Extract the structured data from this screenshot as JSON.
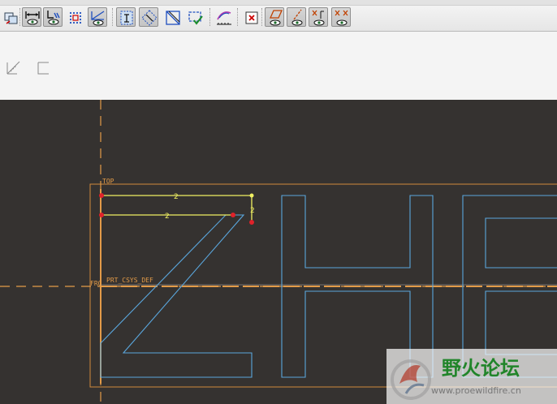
{
  "toolbar": {
    "items": [
      {
        "name": "import-icon",
        "active": false
      },
      {
        "name": "dimension-display-icon",
        "active": true
      },
      {
        "name": "constraint-display-icon",
        "active": true
      },
      {
        "name": "grid-display-icon",
        "active": false
      },
      {
        "name": "vertex-display-icon",
        "active": true
      },
      {
        "name": "shade-closed-loops-icon",
        "active": true
      },
      {
        "name": "highlight-open-ends-icon",
        "active": true
      },
      {
        "name": "overlapping-geometry-icon",
        "active": false
      },
      {
        "name": "sketch-check-icon",
        "active": false
      },
      {
        "name": "sketch-view-icon",
        "active": false
      },
      {
        "name": "delete-icon",
        "active": false
      },
      {
        "name": "datum-plane-display-icon",
        "active": true
      },
      {
        "name": "datum-axis-display-icon",
        "active": true
      },
      {
        "name": "datum-point-display-icon",
        "active": true
      },
      {
        "name": "csys-display-icon",
        "active": true
      }
    ]
  },
  "subbar": {
    "items": [
      "sketch-orientation-icon",
      "rectangle-icon"
    ]
  },
  "canvas": {
    "background": "#353230",
    "sketch_color": "#5aa6dc",
    "selection_color": "#f0f062",
    "datum_color": "#e39b48",
    "labels": {
      "top_plane": "TOP",
      "csys": "PRT_CSYS_DEF",
      "front_plane": "FRO"
    },
    "constraint_markers": [
      "2",
      "2",
      "2"
    ]
  },
  "watermark": {
    "title": "野火论坛",
    "url": "www.proewildfire.cn"
  }
}
